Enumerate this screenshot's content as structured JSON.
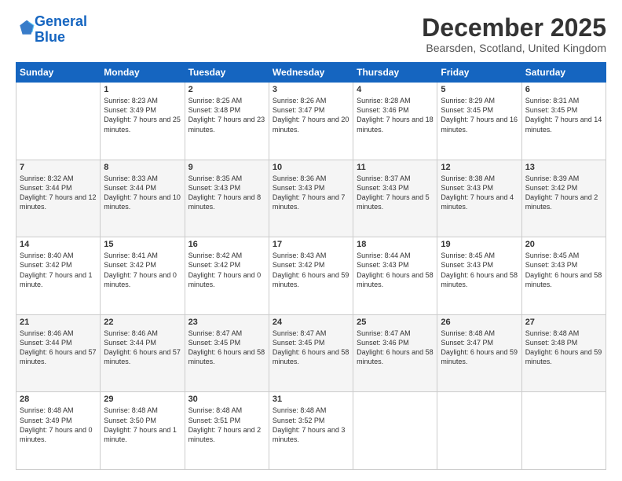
{
  "header": {
    "logo_line1": "General",
    "logo_line2": "Blue",
    "month_title": "December 2025",
    "location": "Bearsden, Scotland, United Kingdom"
  },
  "days_of_week": [
    "Sunday",
    "Monday",
    "Tuesday",
    "Wednesday",
    "Thursday",
    "Friday",
    "Saturday"
  ],
  "weeks": [
    [
      {
        "day": "",
        "sunrise": "",
        "sunset": "",
        "daylight": ""
      },
      {
        "day": "1",
        "sunrise": "Sunrise: 8:23 AM",
        "sunset": "Sunset: 3:49 PM",
        "daylight": "Daylight: 7 hours and 25 minutes."
      },
      {
        "day": "2",
        "sunrise": "Sunrise: 8:25 AM",
        "sunset": "Sunset: 3:48 PM",
        "daylight": "Daylight: 7 hours and 23 minutes."
      },
      {
        "day": "3",
        "sunrise": "Sunrise: 8:26 AM",
        "sunset": "Sunset: 3:47 PM",
        "daylight": "Daylight: 7 hours and 20 minutes."
      },
      {
        "day": "4",
        "sunrise": "Sunrise: 8:28 AM",
        "sunset": "Sunset: 3:46 PM",
        "daylight": "Daylight: 7 hours and 18 minutes."
      },
      {
        "day": "5",
        "sunrise": "Sunrise: 8:29 AM",
        "sunset": "Sunset: 3:45 PM",
        "daylight": "Daylight: 7 hours and 16 minutes."
      },
      {
        "day": "6",
        "sunrise": "Sunrise: 8:31 AM",
        "sunset": "Sunset: 3:45 PM",
        "daylight": "Daylight: 7 hours and 14 minutes."
      }
    ],
    [
      {
        "day": "7",
        "sunrise": "Sunrise: 8:32 AM",
        "sunset": "Sunset: 3:44 PM",
        "daylight": "Daylight: 7 hours and 12 minutes."
      },
      {
        "day": "8",
        "sunrise": "Sunrise: 8:33 AM",
        "sunset": "Sunset: 3:44 PM",
        "daylight": "Daylight: 7 hours and 10 minutes."
      },
      {
        "day": "9",
        "sunrise": "Sunrise: 8:35 AM",
        "sunset": "Sunset: 3:43 PM",
        "daylight": "Daylight: 7 hours and 8 minutes."
      },
      {
        "day": "10",
        "sunrise": "Sunrise: 8:36 AM",
        "sunset": "Sunset: 3:43 PM",
        "daylight": "Daylight: 7 hours and 7 minutes."
      },
      {
        "day": "11",
        "sunrise": "Sunrise: 8:37 AM",
        "sunset": "Sunset: 3:43 PM",
        "daylight": "Daylight: 7 hours and 5 minutes."
      },
      {
        "day": "12",
        "sunrise": "Sunrise: 8:38 AM",
        "sunset": "Sunset: 3:43 PM",
        "daylight": "Daylight: 7 hours and 4 minutes."
      },
      {
        "day": "13",
        "sunrise": "Sunrise: 8:39 AM",
        "sunset": "Sunset: 3:42 PM",
        "daylight": "Daylight: 7 hours and 2 minutes."
      }
    ],
    [
      {
        "day": "14",
        "sunrise": "Sunrise: 8:40 AM",
        "sunset": "Sunset: 3:42 PM",
        "daylight": "Daylight: 7 hours and 1 minute."
      },
      {
        "day": "15",
        "sunrise": "Sunrise: 8:41 AM",
        "sunset": "Sunset: 3:42 PM",
        "daylight": "Daylight: 7 hours and 0 minutes."
      },
      {
        "day": "16",
        "sunrise": "Sunrise: 8:42 AM",
        "sunset": "Sunset: 3:42 PM",
        "daylight": "Daylight: 7 hours and 0 minutes."
      },
      {
        "day": "17",
        "sunrise": "Sunrise: 8:43 AM",
        "sunset": "Sunset: 3:42 PM",
        "daylight": "Daylight: 6 hours and 59 minutes."
      },
      {
        "day": "18",
        "sunrise": "Sunrise: 8:44 AM",
        "sunset": "Sunset: 3:43 PM",
        "daylight": "Daylight: 6 hours and 58 minutes."
      },
      {
        "day": "19",
        "sunrise": "Sunrise: 8:45 AM",
        "sunset": "Sunset: 3:43 PM",
        "daylight": "Daylight: 6 hours and 58 minutes."
      },
      {
        "day": "20",
        "sunrise": "Sunrise: 8:45 AM",
        "sunset": "Sunset: 3:43 PM",
        "daylight": "Daylight: 6 hours and 58 minutes."
      }
    ],
    [
      {
        "day": "21",
        "sunrise": "Sunrise: 8:46 AM",
        "sunset": "Sunset: 3:44 PM",
        "daylight": "Daylight: 6 hours and 57 minutes."
      },
      {
        "day": "22",
        "sunrise": "Sunrise: 8:46 AM",
        "sunset": "Sunset: 3:44 PM",
        "daylight": "Daylight: 6 hours and 57 minutes."
      },
      {
        "day": "23",
        "sunrise": "Sunrise: 8:47 AM",
        "sunset": "Sunset: 3:45 PM",
        "daylight": "Daylight: 6 hours and 58 minutes."
      },
      {
        "day": "24",
        "sunrise": "Sunrise: 8:47 AM",
        "sunset": "Sunset: 3:45 PM",
        "daylight": "Daylight: 6 hours and 58 minutes."
      },
      {
        "day": "25",
        "sunrise": "Sunrise: 8:47 AM",
        "sunset": "Sunset: 3:46 PM",
        "daylight": "Daylight: 6 hours and 58 minutes."
      },
      {
        "day": "26",
        "sunrise": "Sunrise: 8:48 AM",
        "sunset": "Sunset: 3:47 PM",
        "daylight": "Daylight: 6 hours and 59 minutes."
      },
      {
        "day": "27",
        "sunrise": "Sunrise: 8:48 AM",
        "sunset": "Sunset: 3:48 PM",
        "daylight": "Daylight: 6 hours and 59 minutes."
      }
    ],
    [
      {
        "day": "28",
        "sunrise": "Sunrise: 8:48 AM",
        "sunset": "Sunset: 3:49 PM",
        "daylight": "Daylight: 7 hours and 0 minutes."
      },
      {
        "day": "29",
        "sunrise": "Sunrise: 8:48 AM",
        "sunset": "Sunset: 3:50 PM",
        "daylight": "Daylight: 7 hours and 1 minute."
      },
      {
        "day": "30",
        "sunrise": "Sunrise: 8:48 AM",
        "sunset": "Sunset: 3:51 PM",
        "daylight": "Daylight: 7 hours and 2 minutes."
      },
      {
        "day": "31",
        "sunrise": "Sunrise: 8:48 AM",
        "sunset": "Sunset: 3:52 PM",
        "daylight": "Daylight: 7 hours and 3 minutes."
      },
      {
        "day": "",
        "sunrise": "",
        "sunset": "",
        "daylight": ""
      },
      {
        "day": "",
        "sunrise": "",
        "sunset": "",
        "daylight": ""
      },
      {
        "day": "",
        "sunrise": "",
        "sunset": "",
        "daylight": ""
      }
    ]
  ]
}
